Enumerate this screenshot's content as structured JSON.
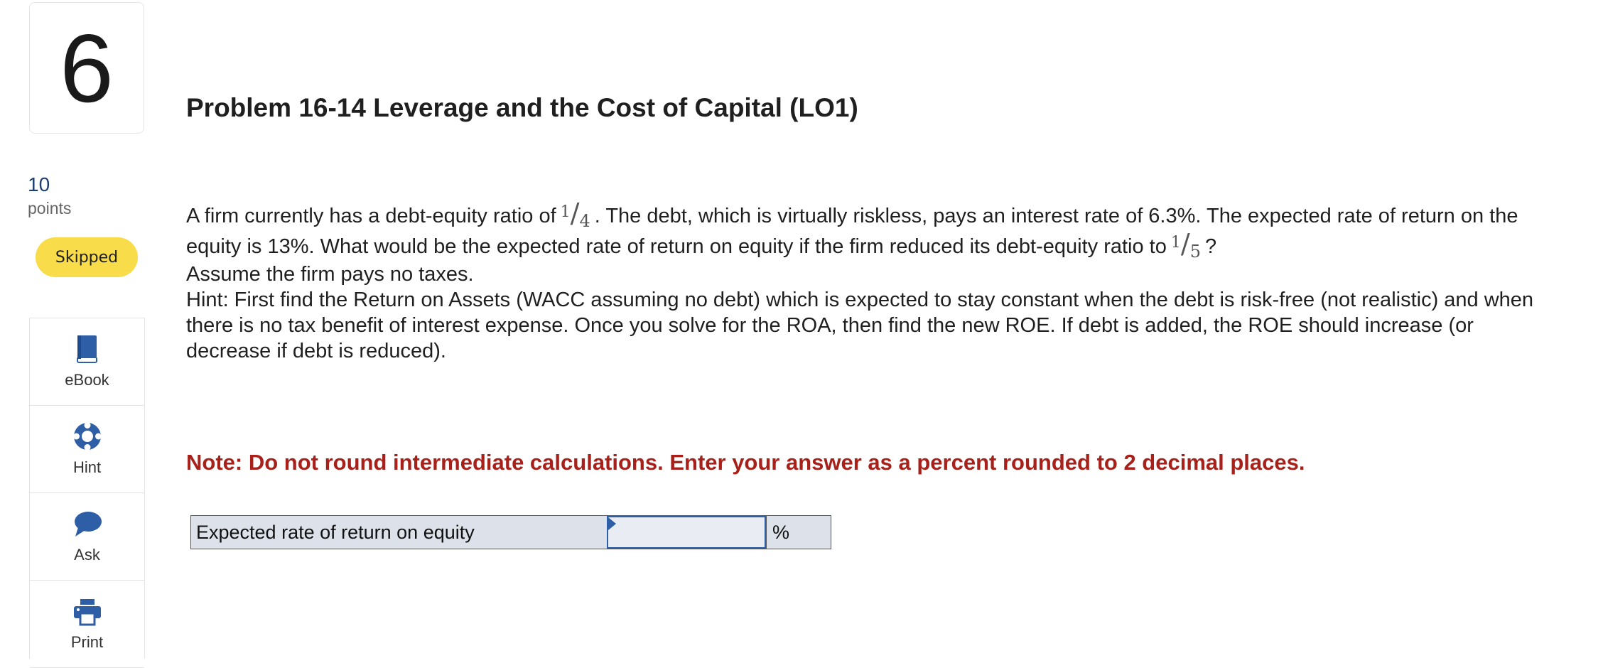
{
  "question": {
    "number": "6",
    "points_value": "10",
    "points_label": "points",
    "status": "Skipped"
  },
  "tools": [
    {
      "label": "eBook",
      "icon": "book-icon"
    },
    {
      "label": "Hint",
      "icon": "lifebuoy-icon"
    },
    {
      "label": "Ask",
      "icon": "speech-bubble-icon"
    },
    {
      "label": "Print",
      "icon": "printer-icon"
    }
  ],
  "problem": {
    "title": "Problem 16-14 Leverage and the Cost of Capital (LO1)",
    "text_a": "A firm currently has a debt-equity ratio of",
    "frac1_num": "1",
    "frac1_den": "4",
    "text_b": ". The debt, which is virtually riskless, pays an interest rate of 6.3%. The expected rate of return on the equity is 13%. What would be the expected rate of return on equity if the firm reduced its debt-equity ratio to",
    "frac2_num": "1",
    "frac2_den": "5",
    "text_c": "?",
    "text_d": "Assume the firm pays no taxes.",
    "hint": "Hint: First find the Return on Assets (WACC assuming no debt) which is expected to stay constant when the debt is risk-free (not realistic) and when there is no tax benefit of interest expense.  Once you solve for the ROA, then find the new ROE. If debt is added, the ROE should increase (or decrease if debt is reduced).",
    "note": "Note: Do not round intermediate calculations. Enter your answer as a percent rounded to 2 decimal places."
  },
  "answer": {
    "label": "Expected rate of return on equity",
    "value": "",
    "unit": "%"
  },
  "colors": {
    "accent": "#2e5ea6",
    "badge": "#f8dc4a",
    "note": "#a8201a",
    "points": "#1d3e6e"
  }
}
